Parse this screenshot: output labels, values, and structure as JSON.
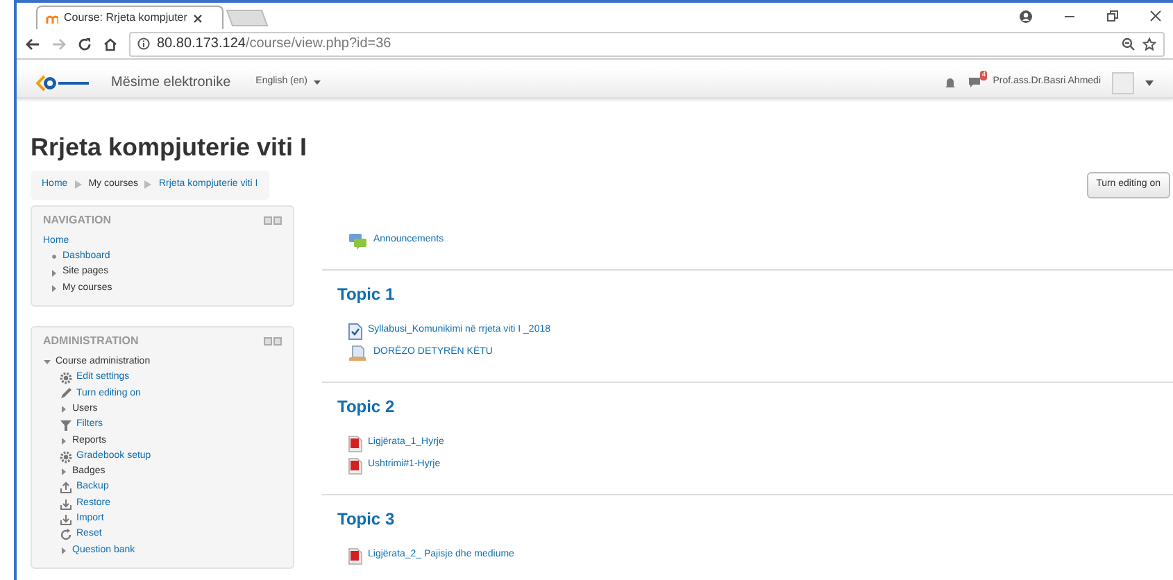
{
  "browser": {
    "tab_title": "Course: Rrjeta kompjuter",
    "url_host": "80.80.173.124",
    "url_path": "/course/view.php?id=36"
  },
  "navbar": {
    "site_name": "Mësime elektronike",
    "language": "English (en)",
    "message_count": "4",
    "user_name": "Prof.ass.Dr.Basri Ahmedi"
  },
  "page": {
    "title": "Rrjeta kompjuterie viti I",
    "breadcrumb": [
      {
        "label": "Home",
        "link": true
      },
      {
        "label": "My courses",
        "link": false
      },
      {
        "label": "Rrjeta kompjuterie viti I",
        "link": true
      }
    ],
    "edit_button": "Turn editing on"
  },
  "navigation": {
    "title": "NAVIGATION",
    "items": [
      {
        "label": "Home",
        "kind": "plain",
        "link": true,
        "children": [
          {
            "label": "Dashboard",
            "kind": "leaf",
            "link": true
          },
          {
            "label": "Site pages",
            "kind": "collapsed",
            "link": false
          },
          {
            "label": "My courses",
            "kind": "collapsed",
            "link": false
          }
        ]
      }
    ]
  },
  "administration": {
    "title": "ADMINISTRATION",
    "items": [
      {
        "label": "Course administration",
        "kind": "expanded",
        "link": false,
        "children": [
          {
            "label": "Edit settings",
            "kind": "gear",
            "link": true
          },
          {
            "label": "Turn editing on",
            "kind": "pencil",
            "link": true
          },
          {
            "label": "Users",
            "kind": "collapsed",
            "link": false
          },
          {
            "label": "Filters",
            "kind": "filter",
            "link": true
          },
          {
            "label": "Reports",
            "kind": "collapsed",
            "link": false
          },
          {
            "label": "Gradebook setup",
            "kind": "gear",
            "link": true
          },
          {
            "label": "Badges",
            "kind": "collapsed",
            "link": false
          },
          {
            "label": "Backup",
            "kind": "upload",
            "link": true
          },
          {
            "label": "Restore",
            "kind": "download",
            "link": true
          },
          {
            "label": "Import",
            "kind": "download",
            "link": true
          },
          {
            "label": "Reset",
            "kind": "reset",
            "link": true
          },
          {
            "label": "Question bank",
            "kind": "collapsed",
            "link": true
          }
        ]
      }
    ]
  },
  "sections": [
    {
      "activities": [
        {
          "label": "Announcements",
          "kind": "forum"
        }
      ]
    },
    {
      "title": "Topic 1",
      "activities": [
        {
          "label": "Syllabusi_Komunikimi në rrjeta viti I _2018",
          "kind": "page"
        },
        {
          "label": "DORËZO DETYRËN KËTU",
          "kind": "assign"
        }
      ]
    },
    {
      "title": "Topic 2",
      "activities": [
        {
          "label": "Ligjërata_1_Hyrje",
          "kind": "pdf"
        },
        {
          "label": "Ushtrimi#1-Hyrje",
          "kind": "pdf"
        }
      ]
    },
    {
      "title": "Topic 3",
      "activities": [
        {
          "label": "Ligjërata_2_ Pajisje dhe mediume",
          "kind": "pdf"
        }
      ]
    }
  ]
}
